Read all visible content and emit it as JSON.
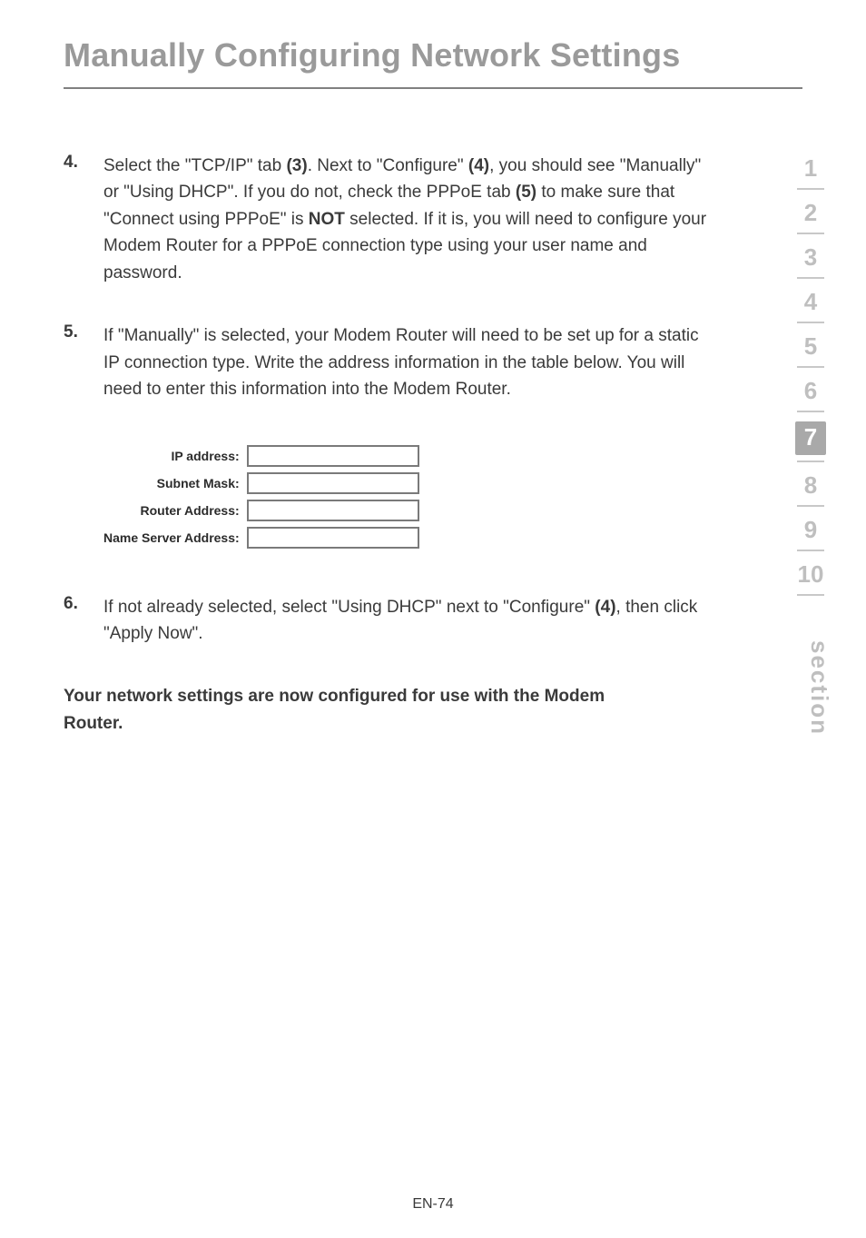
{
  "title": "Manually Configuring Network Settings",
  "steps": {
    "s4": {
      "num": "4.",
      "text_parts": [
        "Select the \"TCP/IP\" tab ",
        "(3)",
        ". Next to \"Configure\" ",
        "(4)",
        ", you should see \"Manually\" or \"Using DHCP\". If you do not, check the PPPoE tab ",
        "(5)",
        " to make sure that \"Connect using PPPoE\" is ",
        "NOT",
        " selected. If it is, you will need to configure your Modem Router for a PPPoE connection type using your user name and password."
      ]
    },
    "s5": {
      "num": "5.",
      "text": "If \"Manually\" is selected, your Modem Router will need to be set up for a static IP connection type. Write the address information in the table below. You will need to enter this information into the Modem Router."
    },
    "s6": {
      "num": "6.",
      "text_parts": [
        "If not already selected, select \"Using DHCP\" next to \"Configure\" ",
        "(4)",
        ", then click \"Apply Now\"."
      ]
    }
  },
  "form_labels": {
    "ip": "IP address:",
    "subnet": "Subnet Mask:",
    "router": "Router Address:",
    "dns": "Name Server Address:"
  },
  "closing": "Your network settings are now configured for use with the Modem Router.",
  "sidebar": {
    "n1": "1",
    "n2": "2",
    "n3": "3",
    "n4": "4",
    "n5": "5",
    "n6": "6",
    "n7": "7",
    "n8": "8",
    "n9": "9",
    "n10": "10",
    "label": "section"
  },
  "footer": "EN-74"
}
